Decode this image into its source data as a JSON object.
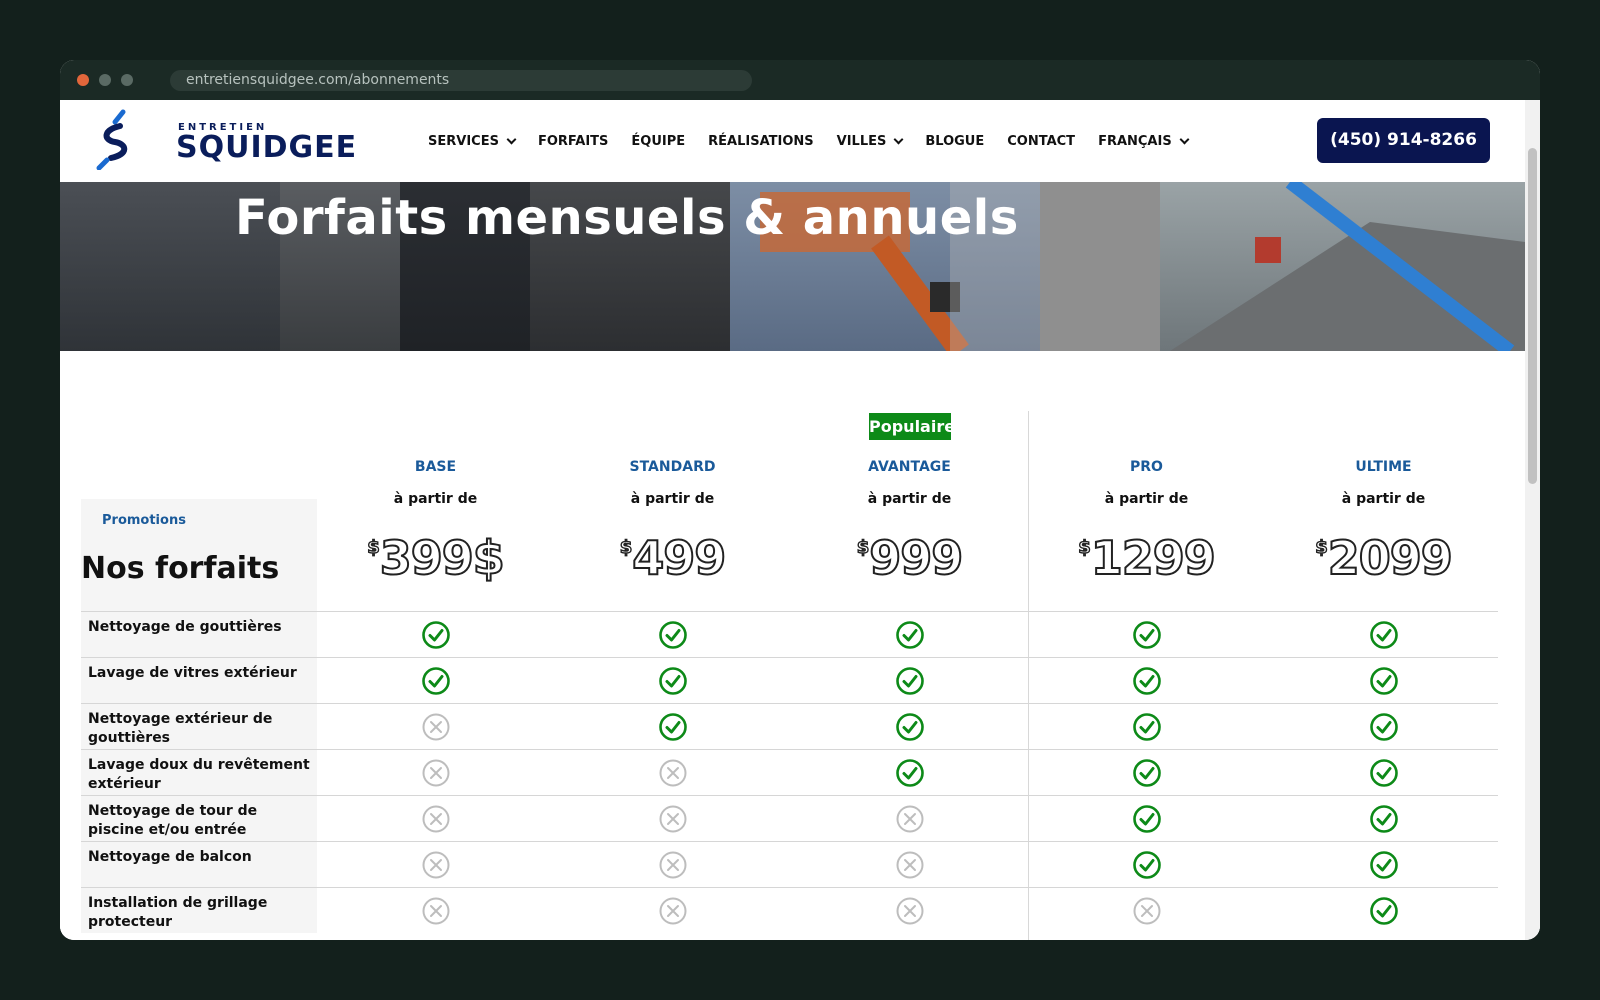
{
  "browser": {
    "url": "entretiensquidgee.com/abonnements"
  },
  "header": {
    "logo_top": "ENTRETIEN",
    "logo_main": "SQUIDGEE",
    "nav": [
      {
        "label": "SERVICES",
        "dropdown": true
      },
      {
        "label": "FORFAITS",
        "dropdown": false
      },
      {
        "label": "ÉQUIPE",
        "dropdown": false
      },
      {
        "label": "RÉALISATIONS",
        "dropdown": false
      },
      {
        "label": "VILLES",
        "dropdown": true
      },
      {
        "label": "BLOGUE",
        "dropdown": false
      },
      {
        "label": "CONTACT",
        "dropdown": false
      },
      {
        "label": "FRANÇAIS",
        "dropdown": true
      }
    ],
    "phone": "(450) 914-8266"
  },
  "hero": {
    "title": "Forfaits mensuels & annuels"
  },
  "pricing": {
    "promotions_label": "Promotions",
    "heading": "Nos forfaits",
    "popular_badge": "Populaire",
    "plans": [
      {
        "name": "BASE",
        "from": "à partir de",
        "currency": "$",
        "price": "399$"
      },
      {
        "name": "STANDARD",
        "from": "à partir de",
        "currency": "$",
        "price": "499"
      },
      {
        "name": "AVANTAGE",
        "from": "à partir de",
        "currency": "$",
        "price": "999"
      },
      {
        "name": "PRO",
        "from": "à partir de",
        "currency": "$",
        "price": "1299"
      },
      {
        "name": "ULTIME",
        "from": "à partir de",
        "currency": "$",
        "price": "2099"
      }
    ],
    "features": [
      {
        "label": "Nettoyage de gouttières",
        "included": [
          true,
          true,
          true,
          true,
          true
        ]
      },
      {
        "label": "Lavage de vitres extérieur",
        "included": [
          true,
          true,
          true,
          true,
          true
        ]
      },
      {
        "label": "Nettoyage extérieur de gouttières",
        "included": [
          false,
          true,
          true,
          true,
          true
        ]
      },
      {
        "label": "Lavage doux du revêtement extérieur",
        "included": [
          false,
          false,
          true,
          true,
          true
        ]
      },
      {
        "label": "Nettoyage de tour de piscine et/ou entrée",
        "included": [
          false,
          false,
          false,
          true,
          true
        ]
      },
      {
        "label": "Nettoyage de balcon",
        "included": [
          false,
          false,
          false,
          true,
          true
        ]
      },
      {
        "label": "Installation de grillage protecteur",
        "included": [
          false,
          false,
          false,
          false,
          true
        ]
      }
    ]
  },
  "colors": {
    "brand_navy": "#0a1550",
    "plan_blue": "#1a5a9a",
    "check_green": "#0d8a18",
    "cross_gray": "#bdbdbd"
  },
  "icons": {
    "included": "check-circle-icon",
    "excluded": "x-circle-icon"
  }
}
